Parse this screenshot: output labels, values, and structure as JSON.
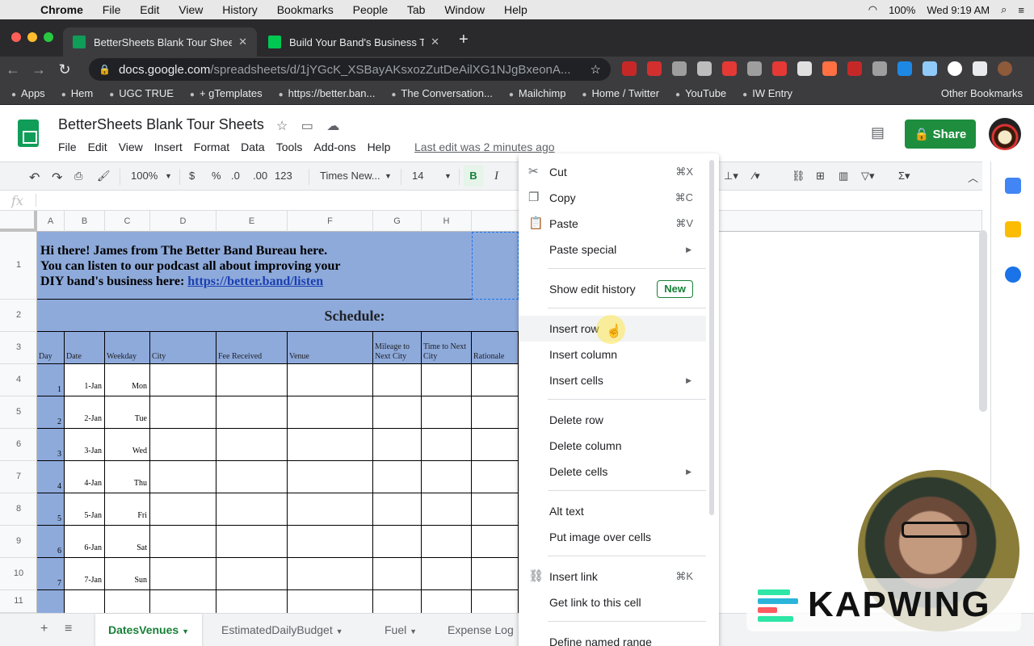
{
  "macos_menubar": {
    "app": "Chrome",
    "menus": [
      "File",
      "Edit",
      "View",
      "History",
      "Bookmarks",
      "People",
      "Tab",
      "Window",
      "Help"
    ],
    "battery": "100%",
    "clock": "Wed 9:19 AM"
  },
  "browser": {
    "tabs": [
      {
        "title": "BetterSheets Blank Tour Sheet",
        "active": true
      },
      {
        "title": "Build Your Band's Business To",
        "active": false
      }
    ],
    "url_host": "docs.google.com",
    "url_path": "/spreadsheets/d/1jYGcK_XSBayAKsxozZutDeAilXG1NJgBxeonA...",
    "bookmarks": [
      "Apps",
      "Hem",
      "UGC TRUE",
      "+ gTemplates",
      "https://better.ban...",
      "The Conversation...",
      "Mailchimp",
      "Home / Twitter",
      "YouTube",
      "IW Entry"
    ],
    "other_bookmarks": "Other Bookmarks"
  },
  "sheets": {
    "doc_title": "BetterSheets Blank Tour Sheets",
    "menus": [
      "File",
      "Edit",
      "View",
      "Insert",
      "Format",
      "Data",
      "Tools",
      "Add-ons",
      "Help"
    ],
    "last_edit": "Last edit was 2 minutes ago",
    "share_label": "Share",
    "toolbar": {
      "zoom": "100%",
      "currency": "$",
      "percent": "%",
      "dec_less": ".0",
      "dec_more": ".00",
      "more_formats": "123",
      "font": "Times New...",
      "font_size": "14",
      "bold": "B"
    },
    "fx_label": "fx"
  },
  "grid": {
    "columns": [
      "A",
      "B",
      "C",
      "D",
      "E",
      "F",
      "G",
      "H"
    ],
    "rows": [
      "1",
      "2",
      "3",
      "4",
      "5",
      "6",
      "7",
      "8",
      "9",
      "10",
      "11"
    ],
    "intro_line1": "Hi there! James from The Better Band Bureau here.",
    "intro_line2": "You can listen to our podcast all about improving your",
    "intro_line3": "DIY band's business here:",
    "intro_link": "https://better.band/listen",
    "schedule_title": "Schedule:",
    "headers": [
      "Day",
      "Date",
      "Weekday",
      "City",
      "Fee Received",
      "Venue",
      "Mileage to Next City",
      "Time to Next City",
      "Rationale"
    ],
    "data_rows": [
      {
        "day": "1",
        "date": "1-Jan",
        "weekday": "Mon"
      },
      {
        "day": "2",
        "date": "2-Jan",
        "weekday": "Tue"
      },
      {
        "day": "3",
        "date": "3-Jan",
        "weekday": "Wed"
      },
      {
        "day": "4",
        "date": "4-Jan",
        "weekday": "Thu"
      },
      {
        "day": "5",
        "date": "5-Jan",
        "weekday": "Fri"
      },
      {
        "day": "6",
        "date": "6-Jan",
        "weekday": "Sat"
      },
      {
        "day": "7",
        "date": "7-Jan",
        "weekday": "Sun"
      }
    ]
  },
  "context_menu": {
    "items": [
      {
        "label": "Cut",
        "shortcut": "⌘X",
        "icon": "scissors-icon"
      },
      {
        "label": "Copy",
        "shortcut": "⌘C",
        "icon": "copy-icon"
      },
      {
        "label": "Paste",
        "shortcut": "⌘V",
        "icon": "clipboard-icon"
      },
      {
        "label": "Paste special"
      },
      {
        "label": "Show edit history",
        "badge": "New"
      },
      {
        "label": "Insert row"
      },
      {
        "label": "Insert column"
      },
      {
        "label": "Insert cells"
      },
      {
        "label": "Delete row"
      },
      {
        "label": "Delete column"
      },
      {
        "label": "Delete cells"
      },
      {
        "label": "Alt text"
      },
      {
        "label": "Put image over cells"
      },
      {
        "label": "Insert link",
        "shortcut": "⌘K",
        "icon": "link-icon"
      },
      {
        "label": "Get link to this cell"
      },
      {
        "label": "Define named range"
      }
    ]
  },
  "sheet_tabs": [
    "DatesVenues",
    "EstimatedDailyBudget",
    "Fuel",
    "Expense Log"
  ],
  "watermark": "KAPWING",
  "colors": {
    "header_blue": "#8eaadb",
    "share_green": "#1e8e3e",
    "link_blue": "#1a3fb0"
  }
}
